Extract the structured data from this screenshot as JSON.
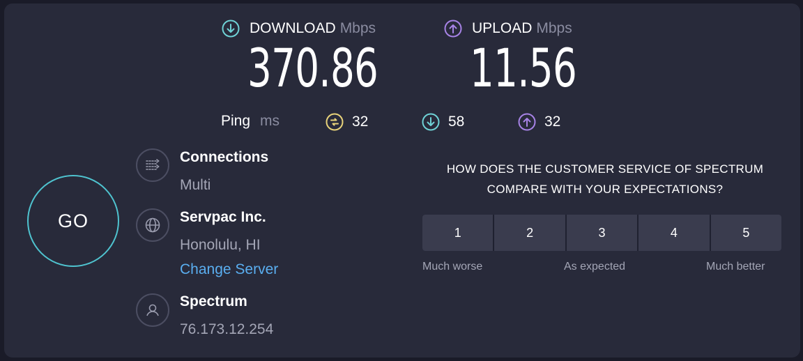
{
  "download": {
    "label": "DOWNLOAD",
    "unit": "Mbps",
    "value": "370.86",
    "icon": "arrow-down-circle-icon",
    "color": "#6fd2d6"
  },
  "upload": {
    "label": "UPLOAD",
    "unit": "Mbps",
    "value": "11.56",
    "icon": "arrow-up-circle-icon",
    "color": "#a783e6"
  },
  "ping": {
    "label": "Ping",
    "unit": "ms",
    "idle": {
      "value": "32",
      "icon": "jitter-icon",
      "color": "#e8d37a"
    },
    "down": {
      "value": "58",
      "icon": "arrow-down-circle-icon",
      "color": "#6fd2d6"
    },
    "up": {
      "value": "32",
      "icon": "arrow-up-circle-icon",
      "color": "#a783e6"
    }
  },
  "go_label": "GO",
  "connections": {
    "title": "Connections",
    "value": "Multi",
    "icon": "connections-icon"
  },
  "server": {
    "title": "Servpac Inc.",
    "location": "Honolulu, HI",
    "change_link": "Change Server",
    "icon": "globe-icon"
  },
  "provider": {
    "title": "Spectrum",
    "ip": "76.173.12.254",
    "icon": "user-icon"
  },
  "survey": {
    "question_line1": "HOW DOES THE CUSTOMER SERVICE OF SPECTRUM",
    "question_line2": "COMPARE WITH YOUR EXPECTATIONS?",
    "options": [
      "1",
      "2",
      "3",
      "4",
      "5"
    ],
    "label_low": "Much worse",
    "label_mid": "As expected",
    "label_high": "Much better"
  }
}
